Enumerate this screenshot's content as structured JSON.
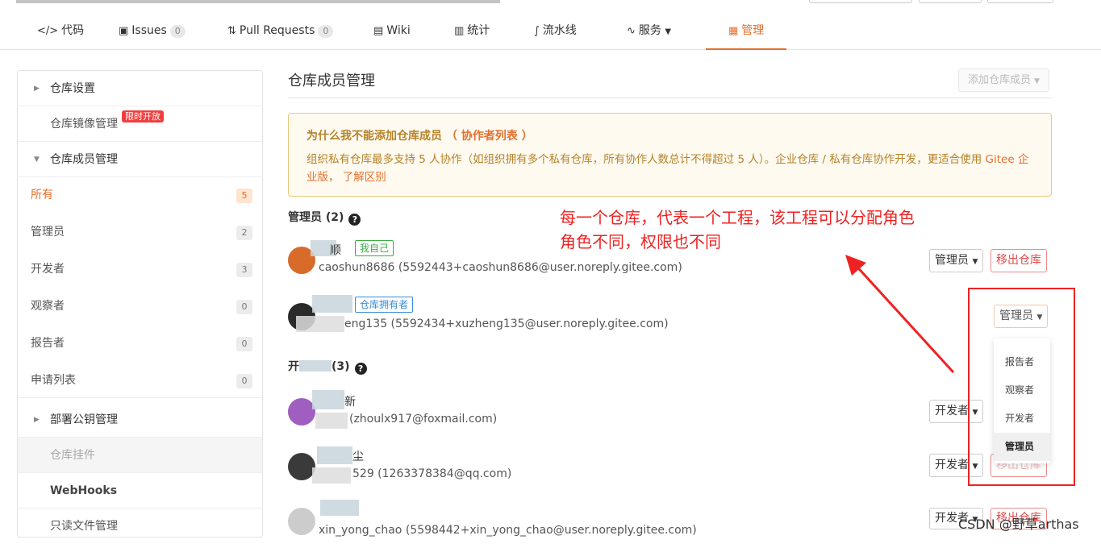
{
  "tabs": [
    {
      "label": "代码",
      "icon": "code-icon"
    },
    {
      "label": "Issues",
      "icon": "issues-icon",
      "count": "0"
    },
    {
      "label": "Pull Requests",
      "icon": "pull-request-icon",
      "count": "0"
    },
    {
      "label": "Wiki",
      "icon": "wiki-icon"
    },
    {
      "label": "统计",
      "icon": "chart-icon"
    },
    {
      "label": "流水线",
      "icon": "pipeline-icon"
    },
    {
      "label": "服务",
      "icon": "service-icon"
    },
    {
      "label": "管理",
      "icon": "manage-icon"
    }
  ],
  "sidebar": {
    "repo_settings": "仓库设置",
    "repo_mirror": "仓库镜像管理",
    "limit_badge": "限时开放",
    "member_mgmt": "仓库成员管理",
    "filters": [
      {
        "label": "所有",
        "count": "5"
      },
      {
        "label": "管理员",
        "count": "2"
      },
      {
        "label": "开发者",
        "count": "3"
      },
      {
        "label": "观察者",
        "count": "0"
      },
      {
        "label": "报告者",
        "count": "0"
      },
      {
        "label": "申请列表",
        "count": "0"
      }
    ],
    "deploy_keys": "部署公钥管理",
    "repo_plugins": "仓库挂件",
    "webhooks": "WebHooks",
    "readonly_files": "只读文件管理"
  },
  "main": {
    "title": "仓库成员管理",
    "add_button": "添加仓库成员",
    "notice_title": "为什么我不能添加仓库成员",
    "notice_title_link": "（ 协作者列表 ）",
    "notice_body": "组织私有仓库最多支持 5 人协作（如组织拥有多个私有仓库，所有协作人数总计不得超过 5 人）。企业仓库 / 私有仓库协作开发，更适合使用",
    "notice_link1": "Gitee 企业版",
    "notice_sep": "，",
    "notice_link2": "了解区别",
    "admins_header": "管理员 (2)",
    "devs_header": "(3)",
    "devs_header_prefix": "开"
  },
  "members": [
    {
      "name": "顺",
      "tag": "我自己",
      "email": "caoshun8686 (5592443+caoshun8686@user.noreply.gitee.com)",
      "role": "管理员",
      "remove": "移出仓库"
    },
    {
      "name": "",
      "tag": "仓库拥有者",
      "email": "eng135 (5592434+xuzheng135@user.noreply.gitee.com)",
      "role": "管理员"
    },
    {
      "name": "新",
      "email": "(zhoulx917@foxmail.com)",
      "role": "开发者"
    },
    {
      "name": "尘",
      "email": "529 (1263378384@qq.com)",
      "role": "开发者",
      "remove": "移出仓库"
    },
    {
      "name": "",
      "email": "xin_yong_chao (5598442+xin_yong_chao@user.noreply.gitee.com)",
      "role": "开发者",
      "remove": "移出仓库"
    }
  ],
  "dropdown": {
    "options": [
      "报告者",
      "观察者",
      "开发者",
      "管理员"
    ],
    "selected": "管理员"
  },
  "annotation": {
    "line1": "每一个仓库，代表一个工程，该工程可以分配角色",
    "line2": "角色不同，权限也不同"
  },
  "watermark": "CSDN @野草arthas",
  "colors": {
    "accent": "#e46f2d",
    "annotation": "#ee2222",
    "notice_text": "#b5822a"
  }
}
